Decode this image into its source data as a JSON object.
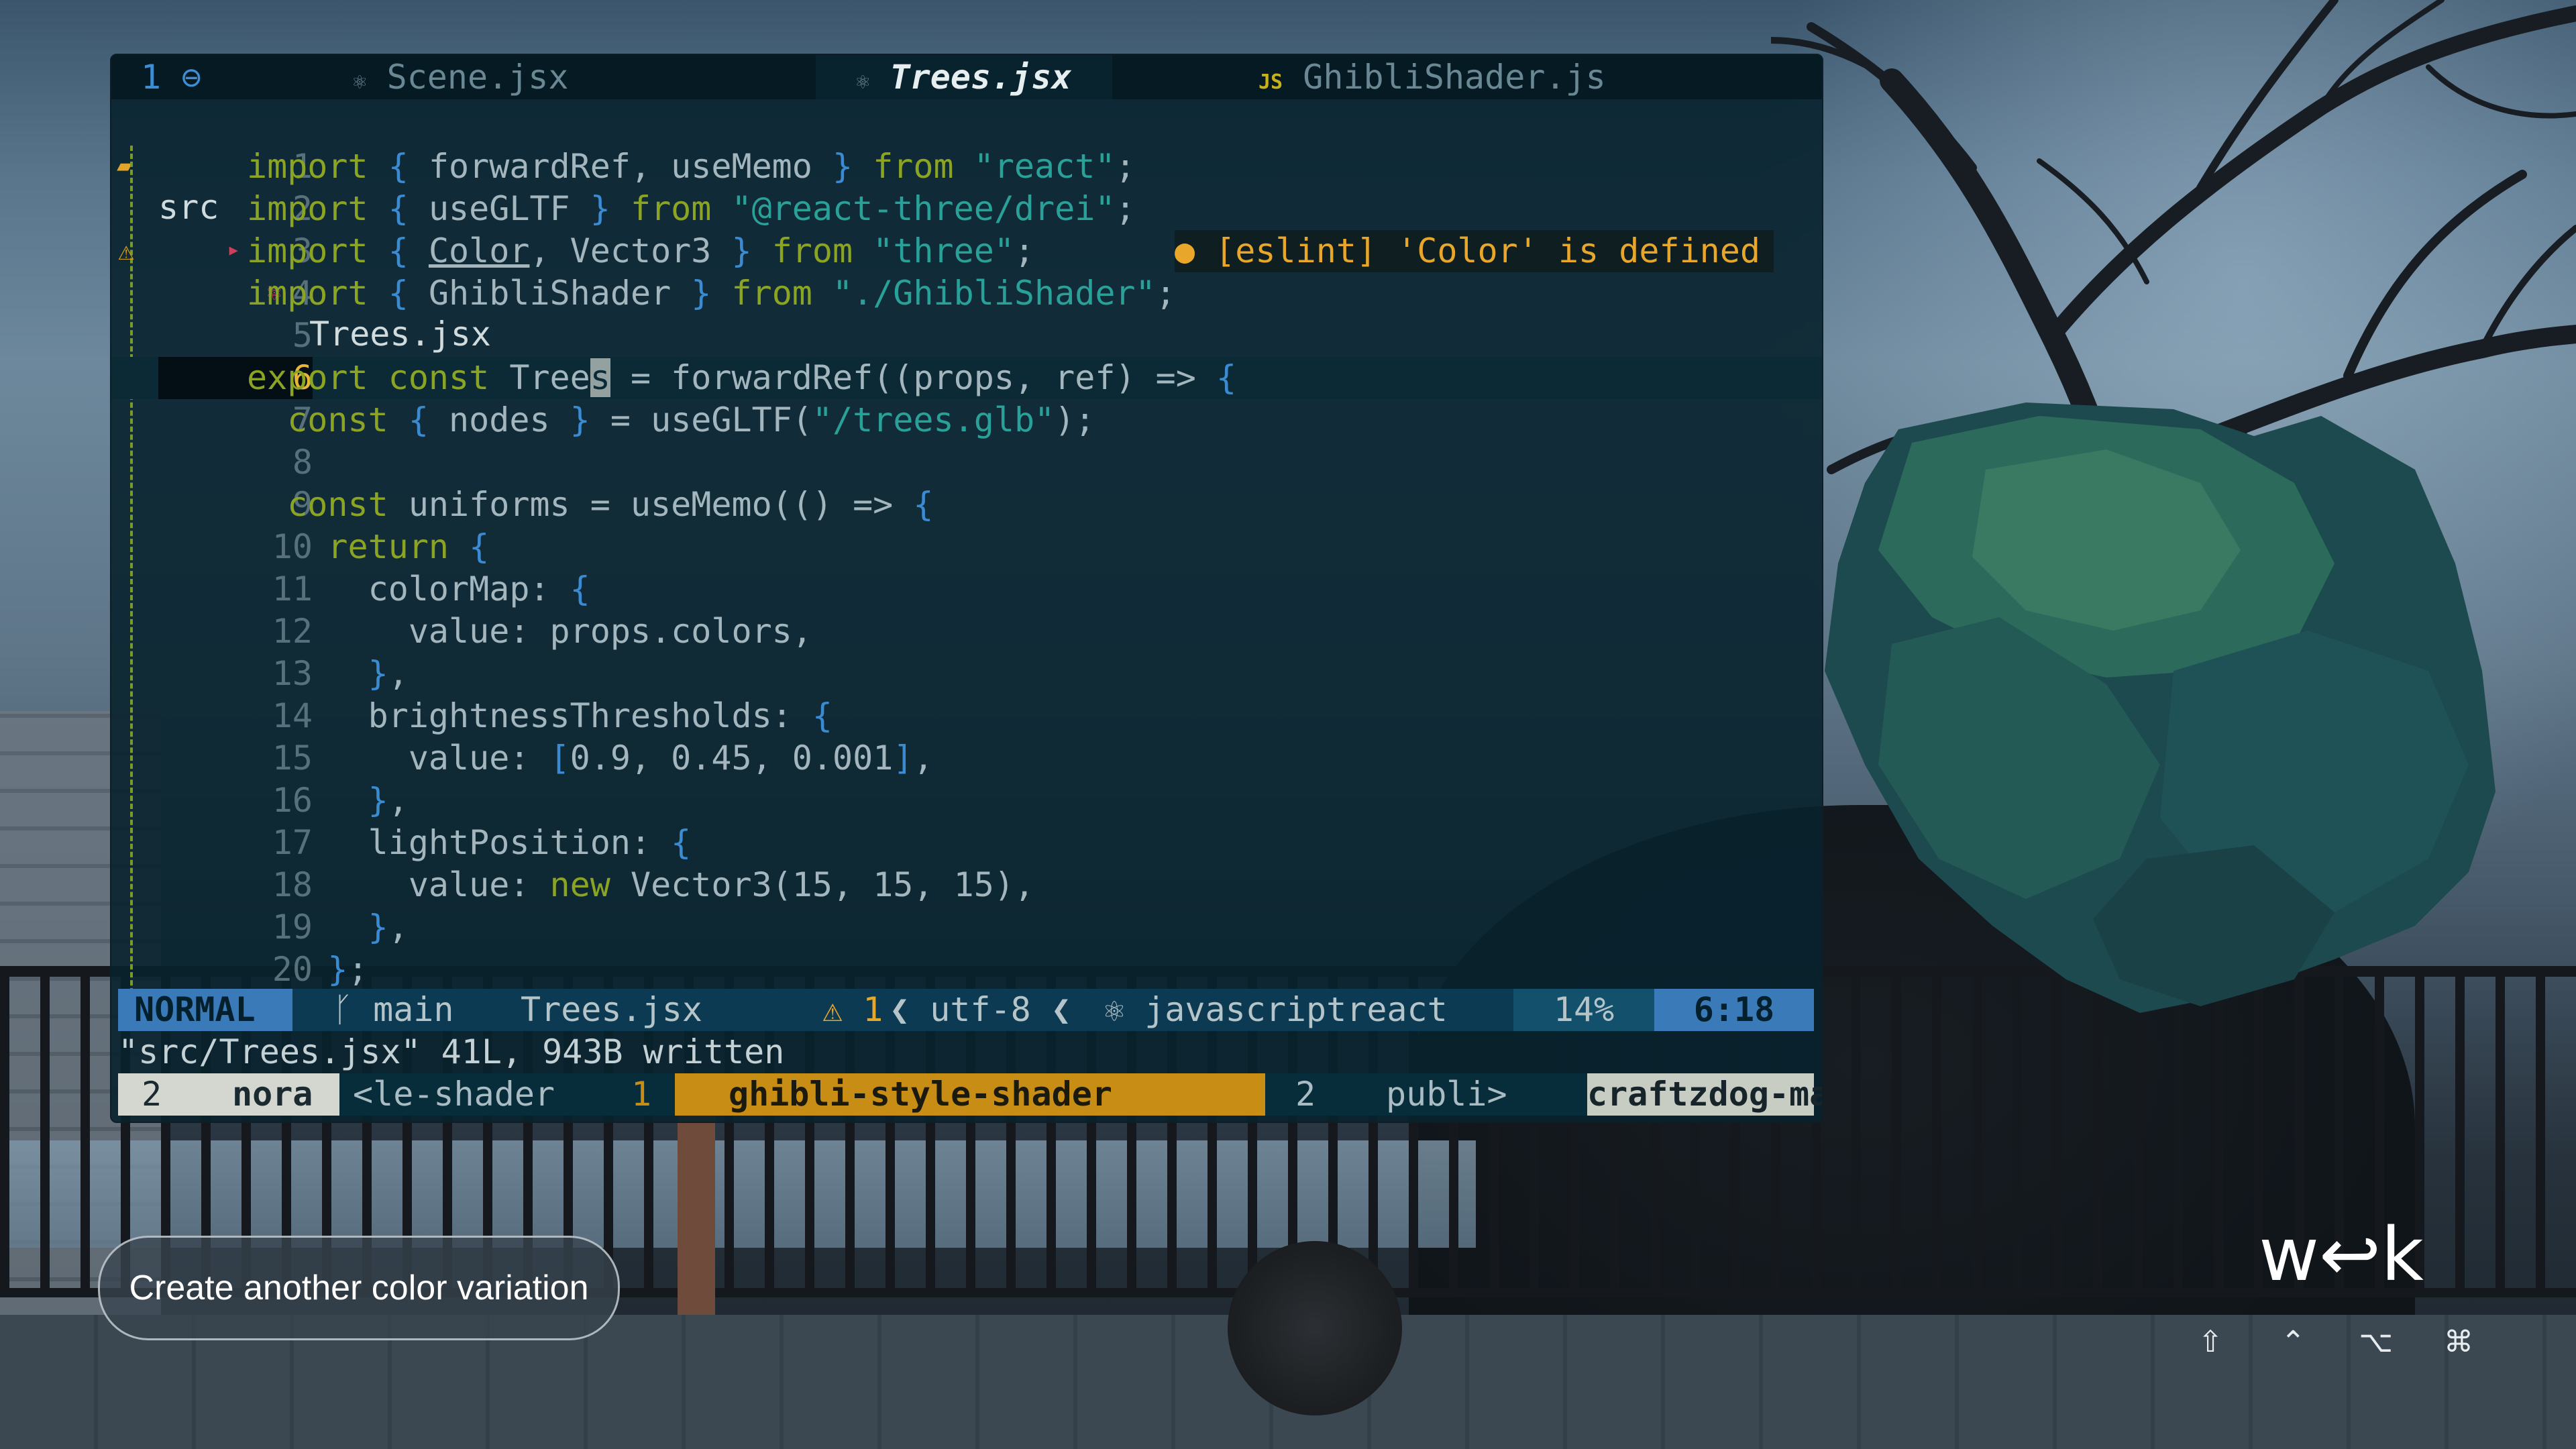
{
  "tabline": {
    "tab_number": "1",
    "tabs": [
      {
        "icon": "⚛",
        "label": "Scene.jsx"
      },
      {
        "icon": "⚛",
        "label": "Trees.jsx"
      },
      {
        "icon": "JS",
        "label": "GhibliShader.js"
      }
    ]
  },
  "breadcrumb": {
    "folder": "src",
    "file": "Trees.jsx"
  },
  "editor": {
    "diagnostic": "● [eslint] 'Color' is defined",
    "lines": [
      {
        "n": "1"
      },
      {
        "n": "2"
      },
      {
        "n": "3"
      },
      {
        "n": "4"
      },
      {
        "n": "5"
      },
      {
        "n": "6"
      },
      {
        "n": "7"
      },
      {
        "n": "8"
      },
      {
        "n": "9"
      },
      {
        "n": "10"
      },
      {
        "n": "11"
      },
      {
        "n": "12"
      },
      {
        "n": "13"
      },
      {
        "n": "14"
      },
      {
        "n": "15"
      },
      {
        "n": "16"
      },
      {
        "n": "17"
      },
      {
        "n": "18"
      },
      {
        "n": "19"
      },
      {
        "n": "20"
      }
    ],
    "code": {
      "l1a": "import",
      "l1b": " { ",
      "l1c": "forwardRef, useMemo",
      "l1d": " } ",
      "l1e": "from ",
      "l1f": "\"react\"",
      "l1g": ";",
      "l2a": "import",
      "l2b": " { ",
      "l2c": "useGLTF",
      "l2d": " } ",
      "l2e": "from ",
      "l2f": "\"@react-three/drei\"",
      "l2g": ";",
      "l3a": "import",
      "l3b": " { ",
      "l3c": "Color",
      "l3d": ", Vector3",
      "l3e": " } ",
      "l3f": "from ",
      "l3g": "\"three\"",
      "l3h": ";",
      "l4a": "import",
      "l4b": " { ",
      "l4c": "GhibliShader",
      "l4d": " } ",
      "l4e": "from ",
      "l4f": "\"./GhibliShader\"",
      "l4g": ";",
      "l6a": "export const ",
      "l6b": "Tree",
      "l6c": "s",
      "l6d": " = forwardRef((props, ref) => ",
      "l6e": "{",
      "l7a": "  const ",
      "l7b": "{ ",
      "l7c": "nodes",
      "l7d": " }",
      "l7e": " = useGLTF(",
      "l7f": "\"/trees.glb\"",
      "l7g": ");",
      "l9a": "  const ",
      "l9b": "uniforms = useMemo(() => ",
      "l9c": "{",
      "l10a": "    return ",
      "l10b": "{",
      "l11a": "      colorMap: ",
      "l11b": "{",
      "l12": "        value: props.colors,",
      "l13a": "      }",
      "l13b": ",",
      "l14a": "      brightnessThresholds: ",
      "l14b": "{",
      "l15a": "        value: ",
      "l15b": "[",
      "l15c": "0.9, 0.45, 0.001",
      "l15d": "]",
      "l15e": ",",
      "l16a": "      }",
      "l16b": ",",
      "l17a": "      lightPosition: ",
      "l17b": "{",
      "l18a": "        value: ",
      "l18b": "new ",
      "l18c": "Vector3(15, 15, 15),",
      "l19a": "      }",
      "l19b": ",",
      "l20a": "    }",
      "l20b": ";"
    }
  },
  "statusline": {
    "mode": "NORMAL",
    "branch": "ᚴ main",
    "file": "Trees.jsx",
    "warnings": "⚠ 1",
    "encoding": "❮ utf-8 ❮",
    "filetype": "⚛ javascriptreact",
    "percent": "14%",
    "position": "6:18"
  },
  "message": "\"src/Trees.jsx\" 41L, 943B written",
  "tmux": {
    "session_num": "2",
    "session": "nora",
    "win1": "<le-shader",
    "win_active_num": "1",
    "win_active": "ghibli-style-shader",
    "win3_num": "2",
    "win3": "publi>",
    "host": "craftzdog-max"
  },
  "suggestion_button": "Create another color variation",
  "logo_text": "w↩k",
  "keys": [
    "⇧",
    "⌃",
    "⌥",
    "⌘"
  ],
  "colors": {
    "terminal_bg": "#082230",
    "keyword": "#8ca423",
    "string": "#2aa198",
    "bracket": "#3a8bd2",
    "warning": "#e8a72a",
    "mode_bg": "#3b7ab8",
    "active_window": "#c88d15"
  }
}
